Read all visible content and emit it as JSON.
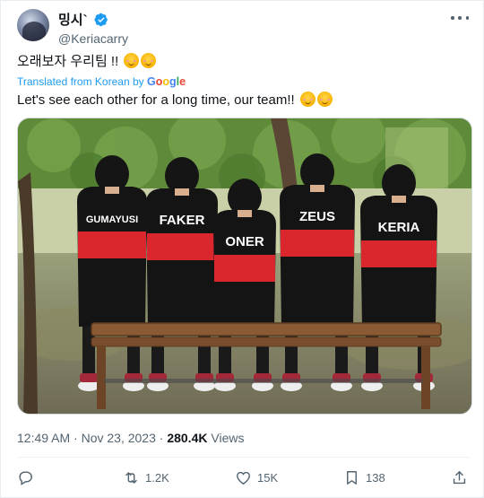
{
  "tweet": {
    "display_name": "밍시`",
    "handle": "@Keriacarry",
    "original_text": "오래보자 우리팀 !!",
    "translated_prefix": "Translated from Korean by ",
    "translated_brand": [
      "G",
      "o",
      "o",
      "g",
      "l",
      "e"
    ],
    "translated_text": "Let's see each other for a long time, our team!!",
    "photo": {
      "jersey_names": [
        "GUMAYUSI",
        "FAKER",
        "ONER",
        "ZEUS",
        "KERIA"
      ]
    },
    "timestamp": "12:49 AM · Nov 23, 2023 · ",
    "views_count": "280.4K",
    "views_label": " Views"
  },
  "actions": {
    "replies": {
      "icon": "reply-icon",
      "count": ""
    },
    "retweets": {
      "icon": "retweet-icon",
      "count": "1.2K"
    },
    "likes": {
      "icon": "heart-icon",
      "count": "15K"
    },
    "bookmarks": {
      "icon": "bookmark-icon",
      "count": "138"
    },
    "share": {
      "icon": "share-icon",
      "count": ""
    }
  },
  "colors": {
    "accent": "#1d9bf0",
    "muted": "#536471",
    "text": "#0f1419",
    "jersey_red": "#d9272d"
  }
}
